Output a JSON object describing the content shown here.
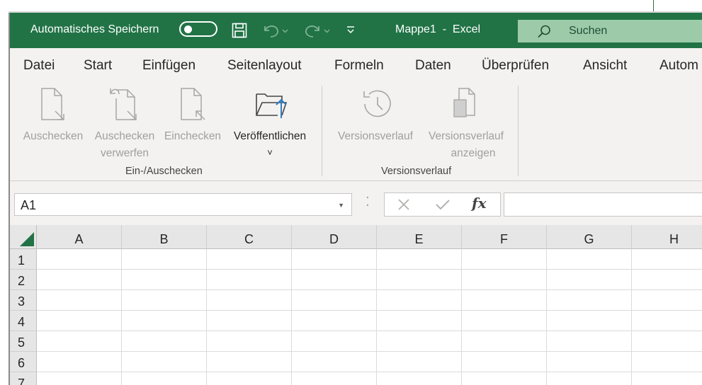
{
  "titlebar": {
    "autosave_label": "Automatisches Speichern",
    "autosave_state": "off",
    "doc_title": "Mappe1  -  Excel",
    "search_placeholder": "Suchen",
    "color": "#217346",
    "icons": [
      "save-icon",
      "undo-icon",
      "redo-icon",
      "customize-quick-access-icon",
      "search-icon"
    ]
  },
  "menu": {
    "tabs": [
      "Datei",
      "Start",
      "Einfügen",
      "Seitenlayout",
      "Formeln",
      "Daten",
      "Überprüfen",
      "Ansicht",
      "Autom"
    ]
  },
  "ribbon": {
    "groups": [
      {
        "label": "Ein-/Auschecken",
        "buttons": [
          {
            "label": "Auschecken",
            "label2": "",
            "enabled": false,
            "icon": "check-out-icon"
          },
          {
            "label": "Auschecken",
            "label2": "verwerfen",
            "enabled": false,
            "icon": "discard-check-out-icon"
          },
          {
            "label": "Einchecken",
            "label2": "",
            "enabled": false,
            "icon": "check-in-icon"
          },
          {
            "label": "Veröffentlichen",
            "label2": "˅",
            "enabled": true,
            "icon": "publish-icon"
          }
        ]
      },
      {
        "label": "Versionsverlauf",
        "buttons": [
          {
            "label": "Versionsverlauf",
            "label2": "",
            "enabled": false,
            "icon": "version-history-icon"
          },
          {
            "label": "Versionsverlauf",
            "label2": "anzeigen",
            "enabled": false,
            "icon": "view-version-history-icon"
          }
        ]
      }
    ]
  },
  "formula_bar": {
    "name_box": "A1",
    "formula": "",
    "icons": [
      "cancel-icon",
      "enter-icon",
      "insert-function-icon"
    ],
    "fx_label": "fx"
  },
  "grid": {
    "columns": [
      "A",
      "B",
      "C",
      "D",
      "E",
      "F",
      "G",
      "H"
    ],
    "rows": [
      "1",
      "2",
      "3",
      "4",
      "5",
      "6",
      "7"
    ]
  }
}
